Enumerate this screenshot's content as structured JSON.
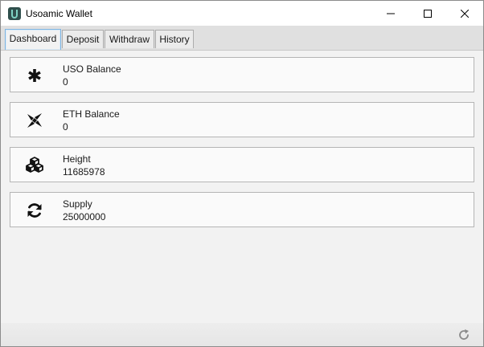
{
  "window": {
    "title": "Usoamic Wallet",
    "app_icon": "usoamic-logo-icon",
    "controls": [
      "minimize-icon",
      "maximize-icon",
      "close-icon"
    ]
  },
  "tabs": [
    {
      "label": "Dashboard",
      "active": true
    },
    {
      "label": "Deposit",
      "active": false
    },
    {
      "label": "Withdraw",
      "active": false
    },
    {
      "label": "History",
      "active": false
    }
  ],
  "cards": [
    {
      "icon": "asterisk-icon",
      "label": "USO Balance",
      "value": "0"
    },
    {
      "icon": "eth-icon",
      "label": "ETH Balance",
      "value": "0"
    },
    {
      "icon": "cubes-icon",
      "label": "Height",
      "value": "11685978"
    },
    {
      "icon": "sync-icon",
      "label": "Supply",
      "value": "25000000"
    }
  ],
  "statusbar": {
    "refresh_icon": "refresh-icon"
  },
  "colors": {
    "active_tab_border": "#7fb4e0",
    "app_icon_bg": "#2f4f4c",
    "app_icon_accent": "#7fd3c3"
  }
}
